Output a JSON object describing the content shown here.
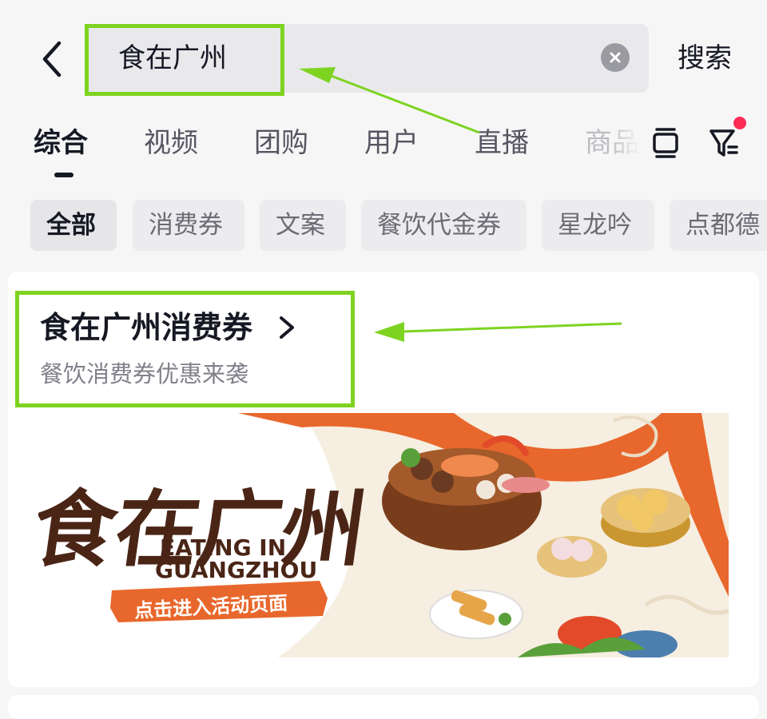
{
  "search": {
    "query": "食在广州",
    "submit_label": "搜索"
  },
  "tabs": [
    {
      "label": "综合"
    },
    {
      "label": "视频"
    },
    {
      "label": "团购"
    },
    {
      "label": "用户"
    },
    {
      "label": "直播"
    },
    {
      "label": "商品"
    }
  ],
  "chips": [
    {
      "label": "全部"
    },
    {
      "label": "消费券"
    },
    {
      "label": "文案"
    },
    {
      "label": "餐饮代金券"
    },
    {
      "label": "星龙吟"
    },
    {
      "label": "点都德"
    }
  ],
  "result_card": {
    "title": "食在广州消费券",
    "subtitle": "餐饮消费券优惠来袭",
    "banner": {
      "logo_text": "食在广州",
      "english_line1": "EATING IN",
      "english_line2": "GUANGZHOU",
      "cta_label": "点击进入活动页面"
    }
  },
  "colors": {
    "highlight": "#7ed321",
    "accent_red": "#fe2c55",
    "banner_orange": "#e8672c",
    "banner_brown": "#4a2516"
  },
  "icons": [
    "back-arrow-icon",
    "clear-icon",
    "tablet-icon",
    "filter-icon",
    "chevron-right-icon"
  ]
}
